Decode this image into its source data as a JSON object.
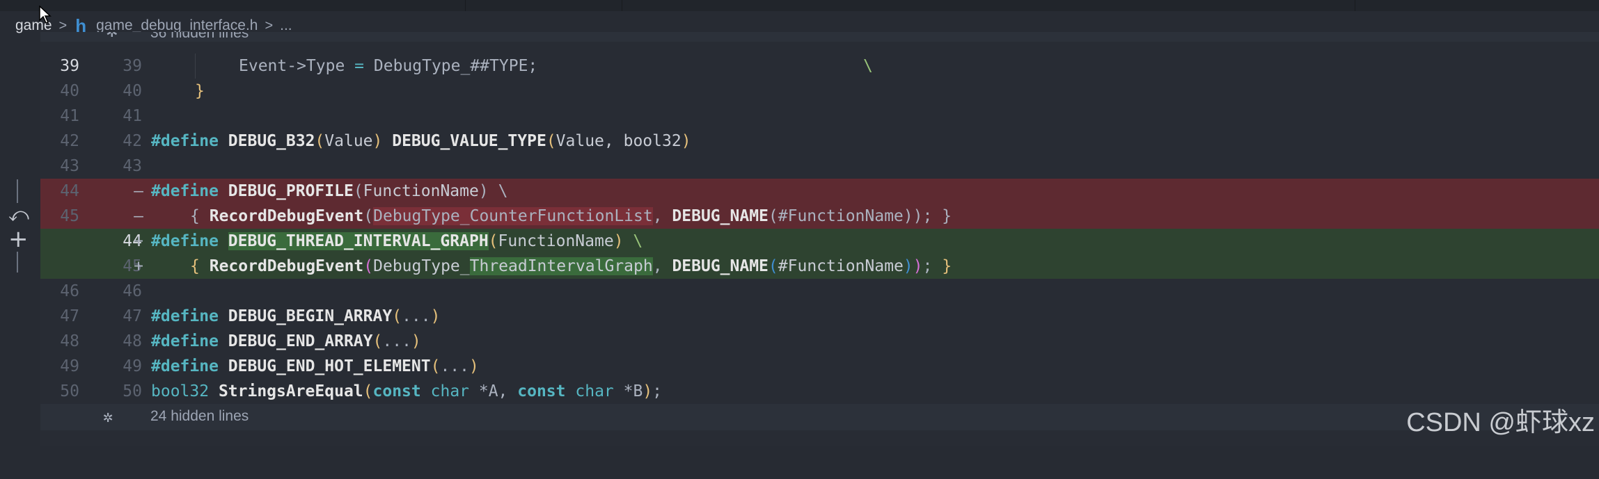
{
  "breadcrumb": {
    "root": "game",
    "sep": ">",
    "file_icon": "h",
    "file": "game_debug_interface.h",
    "tail": "..."
  },
  "hidden_top": {
    "text": "36 hidden lines"
  },
  "rows": [
    {
      "old": "39",
      "new": "39",
      "kind": "ctx",
      "current": true
    },
    {
      "old": "40",
      "new": "40",
      "kind": "ctx"
    },
    {
      "old": "41",
      "new": "41",
      "kind": "ctx"
    },
    {
      "old": "42",
      "new": "42",
      "kind": "ctx"
    },
    {
      "old": "43",
      "new": "43",
      "kind": "ctx"
    },
    {
      "old": "44",
      "new": "",
      "kind": "del",
      "mark": "—"
    },
    {
      "old": "45",
      "new": "",
      "kind": "del",
      "mark": "—"
    },
    {
      "old": "",
      "new": "44",
      "kind": "add",
      "mark": "+"
    },
    {
      "old": "",
      "new": "45",
      "kind": "add",
      "mark": "+"
    },
    {
      "old": "46",
      "new": "46",
      "kind": "ctx"
    },
    {
      "old": "47",
      "new": "47",
      "kind": "ctx"
    },
    {
      "old": "48",
      "new": "48",
      "kind": "ctx"
    },
    {
      "old": "49",
      "new": "49",
      "kind": "ctx"
    },
    {
      "old": "50",
      "new": "50",
      "kind": "ctx"
    }
  ],
  "code": {
    "l39": {
      "a": "Event->Type ",
      "eq": "=",
      "b": " DebugType_##TYPE;",
      "bs": "\\"
    },
    "l40": {
      "brace": "}"
    },
    "l42": {
      "def": "#define",
      "name": "DEBUG_B32",
      "open": "(",
      "arg": "Value",
      "close": ")",
      "name2": "DEBUG_VALUE_TYPE",
      "args2": "Value, bool32"
    },
    "l44": {
      "def": "#define",
      "name": "DEBUG_PROFILE",
      "open": "(",
      "arg": "FunctionName",
      "close": ")",
      "bs": "\\"
    },
    "l45": {
      "ob": "{",
      "fn": "RecordDebugEvent",
      "open": "(",
      "arg1": "DebugType_CounterFunctionList",
      "comma": ", ",
      "mac": "DEBUG_NAME",
      "open2": "(",
      "arg2": "#FunctionName",
      "close2": "))",
      "end": "; }"
    },
    "l44n": {
      "def": "#define",
      "name": "DEBUG_THREAD_INTERVAL_GRAPH",
      "open": "(",
      "arg": "FunctionName",
      "close": ")",
      "bs": "\\"
    },
    "l45n": {
      "ob": "{",
      "fn": "RecordDebugEvent",
      "open": "(",
      "arg1": "DebugType_",
      "arg1b": "ThreadIntervalGraph",
      "comma": ", ",
      "mac": "DEBUG_NAME",
      "open2": "(",
      "arg2": "#FunctionName",
      "close2": ")",
      "close3": ")",
      "semi": ";",
      "cb": "}"
    },
    "l47": {
      "def": "#define",
      "name": "DEBUG_BEGIN_ARRAY",
      "open": "(",
      "arg": "...",
      "close": ")"
    },
    "l48": {
      "def": "#define",
      "name": "DEBUG_END_ARRAY",
      "open": "(",
      "arg": "...",
      "close": ")"
    },
    "l49": {
      "def": "#define",
      "name": "DEBUG_END_HOT_ELEMENT",
      "open": "(",
      "arg": "...",
      "close": ")"
    },
    "l50": {
      "t": "bool32 ",
      "fn": "StringsAreEqual",
      "open": "(",
      "c1": "const",
      "ch1": "char",
      "a1": " *A, ",
      "c2": "const",
      "ch2": "char",
      "a2": " *B",
      "close": ")",
      "semi": ";"
    }
  },
  "hidden_bottom": {
    "text": "24 hidden lines"
  },
  "watermark": "CSDN @虾球xz"
}
